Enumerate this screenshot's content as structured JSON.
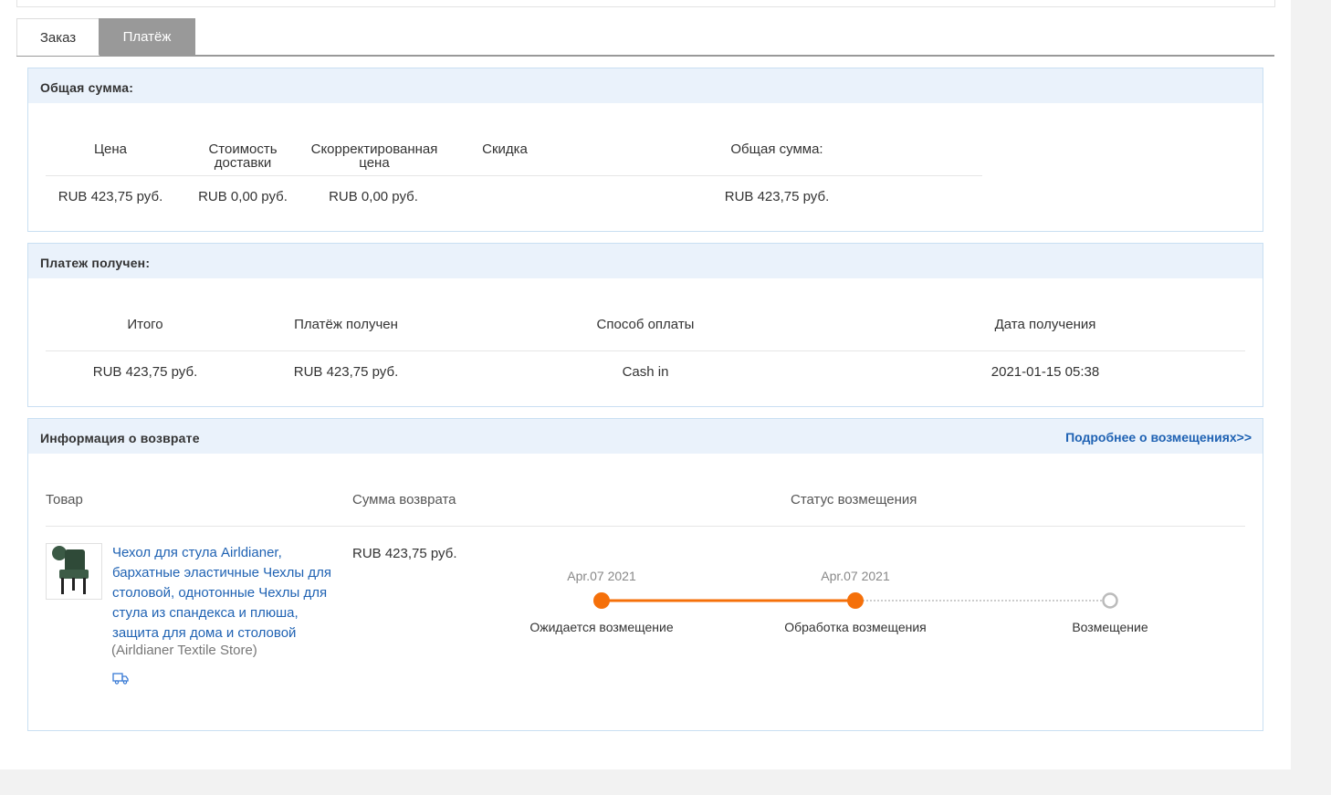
{
  "tabs": [
    {
      "label": "Заказ",
      "active": false
    },
    {
      "label": "Платёж",
      "active": true
    }
  ],
  "total_panel": {
    "title": "Общая сумма:",
    "headers": {
      "price": "Цена",
      "shipping_line1": "Стоимость",
      "shipping_line2": "доставки",
      "adjusted_line1": "Скорректированная",
      "adjusted_line2": "цена",
      "discount": "Скидка",
      "total": "Общая сумма:"
    },
    "values": {
      "price": "RUB 423,75 руб.",
      "shipping": "RUB 0,00 руб.",
      "adjusted": "RUB 0,00 руб.",
      "discount": "",
      "total": "RUB 423,75 руб."
    }
  },
  "payment_panel": {
    "title": "Платеж получен:",
    "headers": {
      "subtotal": "Итого",
      "received": "Платёж получен",
      "method": "Способ оплаты",
      "date": "Дата получения"
    },
    "values": {
      "subtotal": "RUB 423,75 руб.",
      "received": "RUB 423,75 руб.",
      "method": "Cash in",
      "date": "2021-01-15 05:38"
    }
  },
  "refund_panel": {
    "title": "Информация о возврате",
    "link": "Подробнее о возмещениях>>",
    "headers": {
      "product": "Товар",
      "amount": "Сумма возврата",
      "status": "Статус возмещения"
    },
    "product": {
      "name_lines": [
        "Чехол для стула Airldianer,",
        "бархатные эластичные Чехлы для",
        "столовой, однотонные Чехлы для",
        "стула из спандекса и плюша,",
        "защита для дома и столовой"
      ],
      "store": "(Airldianer Textile Store)",
      "image_icon": "chair-image",
      "shipping_icon": "truck-icon"
    },
    "amount": "RUB 423,75 руб.",
    "steps": [
      {
        "date": "Apr.07 2021",
        "label": "Ожидается возмещение",
        "done": true
      },
      {
        "date": "Apr.07 2021",
        "label": "Обработка возмещения",
        "done": true
      },
      {
        "date": "",
        "label": "Возмещение",
        "done": false
      }
    ],
    "colors": {
      "done": "#f5700a",
      "pending": "#bbbbbb"
    }
  }
}
